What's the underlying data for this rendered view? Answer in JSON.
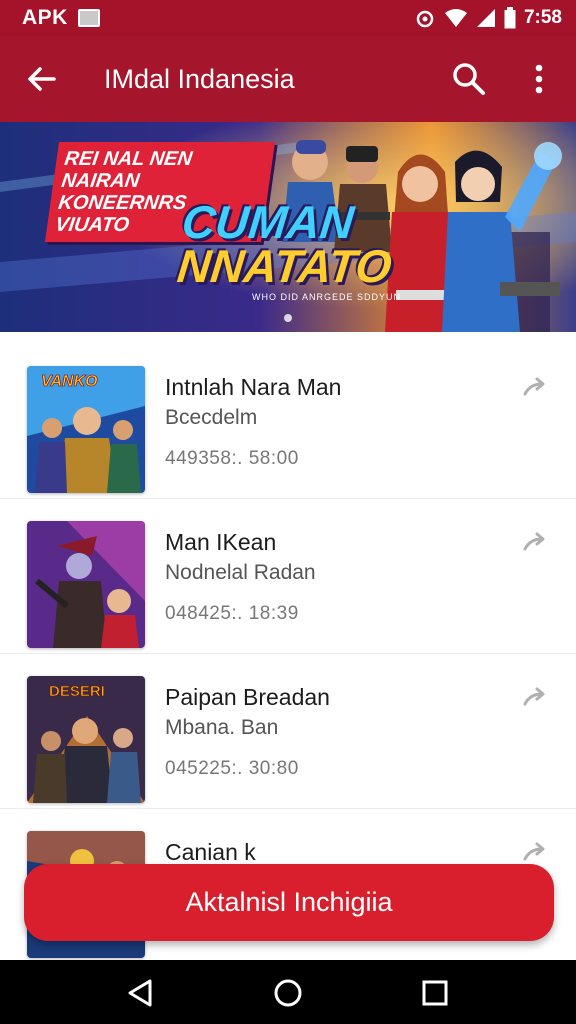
{
  "status_bar": {
    "carrier": "APK",
    "time": "7:58",
    "icons": [
      "notification-icon",
      "alarm-icon",
      "wifi-icon",
      "signal-icon",
      "battery-icon"
    ]
  },
  "app_bar": {
    "title": "IMdal Indanesia",
    "icons": [
      "back-arrow-icon",
      "search-icon",
      "more-vert-icon"
    ]
  },
  "banner": {
    "tag_line1": "REI NAL NEN NAIRAN",
    "tag_line2": "KONEERNRS VIUATO",
    "headline1": "CUMAN",
    "headline2": "NNATATO",
    "caption": "WHO DID ANRGEDE SDDYUN"
  },
  "list": {
    "items": [
      {
        "title": "Intnlah Nara Man",
        "subtitle": "Bcecdelm",
        "meta": "449358:. 58:00",
        "thumb_label": "VANKO"
      },
      {
        "title": "Man IKean",
        "subtitle": "Nodnelal Radan",
        "meta": "048425:. 18:39",
        "thumb_label": ""
      },
      {
        "title": "Paipan Breadan",
        "subtitle": "Mbana. Ban",
        "meta": "045225:. 30:80",
        "thumb_label": "DESERI"
      },
      {
        "title": "Canian k",
        "subtitle": "",
        "meta": "",
        "thumb_label": ""
      }
    ]
  },
  "cta": {
    "label": "Aktalnisl Inchigiia"
  },
  "nav_bar": {
    "icons": [
      "back-triangle-icon",
      "home-circle-icon",
      "recents-square-icon"
    ]
  },
  "colors": {
    "app_bar": "#a5162c",
    "status_bar": "#a5132a",
    "cta": "#d91f2e",
    "nav_bar": "#000000"
  }
}
